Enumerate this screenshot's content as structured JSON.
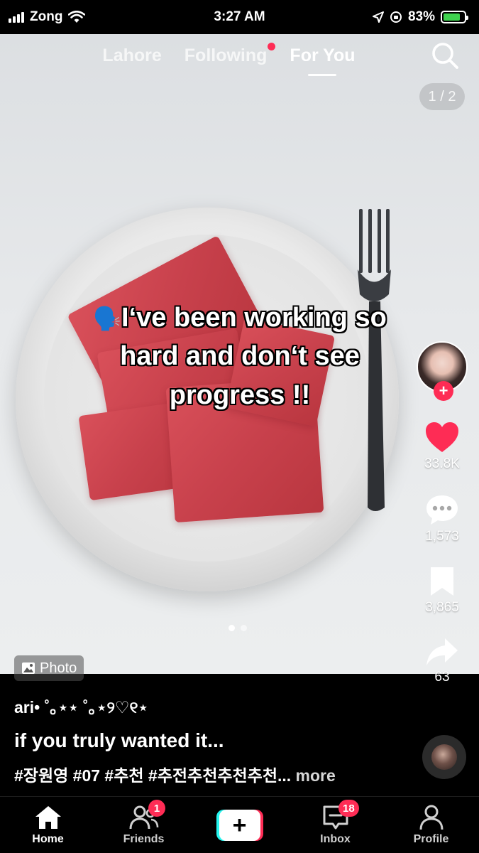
{
  "status_bar": {
    "carrier": "Zong",
    "time": "3:27 AM",
    "battery": "83%",
    "battery_level": 0.83
  },
  "top_nav": {
    "tabs": [
      "Lahore",
      "Following",
      "For You"
    ],
    "active_tab": "For You",
    "following_has_dot": true
  },
  "photo": {
    "page_indicator": "1 / 2",
    "overlay_emoji": "🗣️",
    "overlay_text": "I‘ve been working so hard and don‘t see progress !!",
    "badge_label": "Photo",
    "slide_count": 2,
    "current_slide": 1
  },
  "rail": {
    "likes": "33.8K",
    "comments": "1,573",
    "saves": "3,865",
    "shares": "63"
  },
  "post": {
    "username": "ari• ˚｡⋆⋆ ˚｡⋆୨♡୧⋆",
    "caption": "if you truly wanted it...",
    "hashtags": "#장원영 #07 #추천 #추전추천추천추천...",
    "more_label": " more"
  },
  "tabbar": {
    "home": "Home",
    "friends": "Friends",
    "friends_badge": "1",
    "inbox": "Inbox",
    "inbox_badge": "18",
    "profile": "Profile"
  },
  "colors": {
    "accent": "#fe2c55",
    "create_left": "#25f4ee",
    "battery_fill": "#3fd34f",
    "watermelon": "#c8414c"
  }
}
